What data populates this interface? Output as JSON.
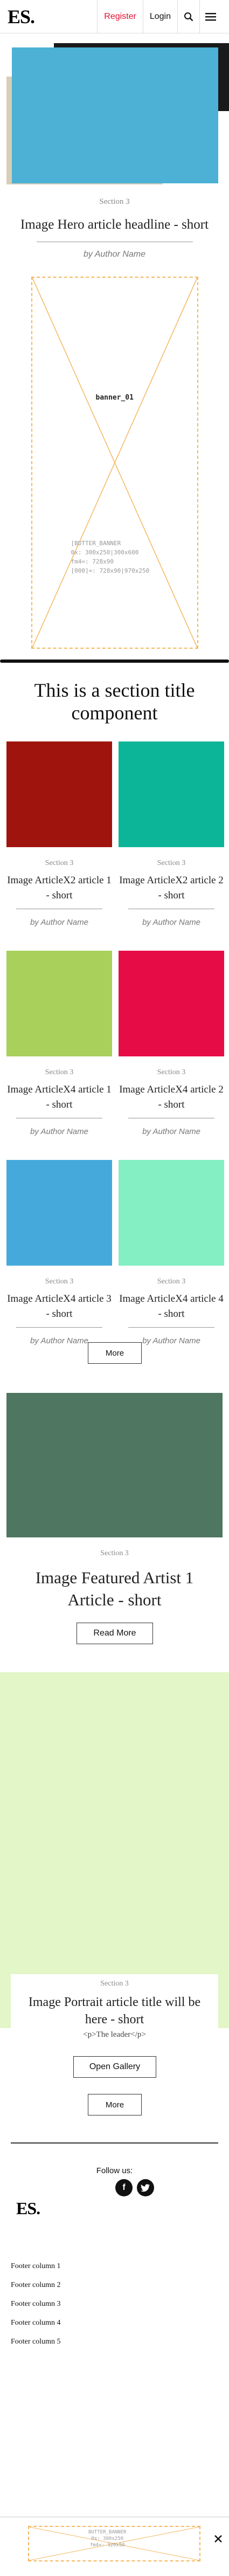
{
  "header": {
    "logo": "ES.",
    "register_label": "Register",
    "login_label": "Login"
  },
  "hero": {
    "section": "Section 3",
    "headline": "Image Hero article headline - short",
    "author": "by Author Name"
  },
  "banner_top": {
    "name": "banner_01",
    "info": "[BUTTER_BANNER\n0x: 300x250|300x600\nfm4=: 728x90\n[000]=: 728x90|970x250"
  },
  "section_title": "This is a section title component",
  "grid_cards": [
    {
      "section": "Section 3",
      "headline": "Image ArticleX2 article 1 - short",
      "author": "by Author Name",
      "color": "#a0140e"
    },
    {
      "section": "Section 3",
      "headline": "Image ArticleX2 article 2 - short",
      "author": "by Author Name",
      "color": "#0db598"
    },
    {
      "section": "Section 3",
      "headline": "Image ArticleX4 article 1 - short",
      "author": "by Author Name",
      "color": "#a8d05b"
    },
    {
      "section": "Section 3",
      "headline": "Image ArticleX4 article 2 - short",
      "author": "by Author Name",
      "color": "#e60d47"
    },
    {
      "section": "Section 3",
      "headline": "Image ArticleX4 article 3 - short",
      "author": "by Author Name",
      "color": "#46a9dc"
    },
    {
      "section": "Section 3",
      "headline": "Image ArticleX4 article 4 - short",
      "author": "by Author Name",
      "color": "#83efc3"
    }
  ],
  "more_label_1": "More",
  "featured": {
    "section": "Section 3",
    "headline": "Image Featured Artist 1 Article - short",
    "read_more": "Read More",
    "color": "#4e7660"
  },
  "portrait": {
    "section": "Section 3",
    "headline": "Image Portrait article title will be here - short",
    "leader": "<p>The leader</p>",
    "open_gallery": "Open Gallery",
    "color": "#e2f6c8"
  },
  "more_label_2": "More",
  "footer": {
    "follow_label": "Follow us:",
    "logo": "ES.",
    "columns": [
      "Footer column 1",
      "Footer column 2",
      "Footer column 3",
      "Footer column 4",
      "Footer column 5"
    ]
  },
  "bottom_banner": {
    "info": "BUTTER_BANNER\n0x: 300x250\nfm4=: 320x50"
  },
  "icons": [
    "search-icon",
    "menu-icon",
    "facebook-icon",
    "twitter-icon",
    "close-icon"
  ]
}
